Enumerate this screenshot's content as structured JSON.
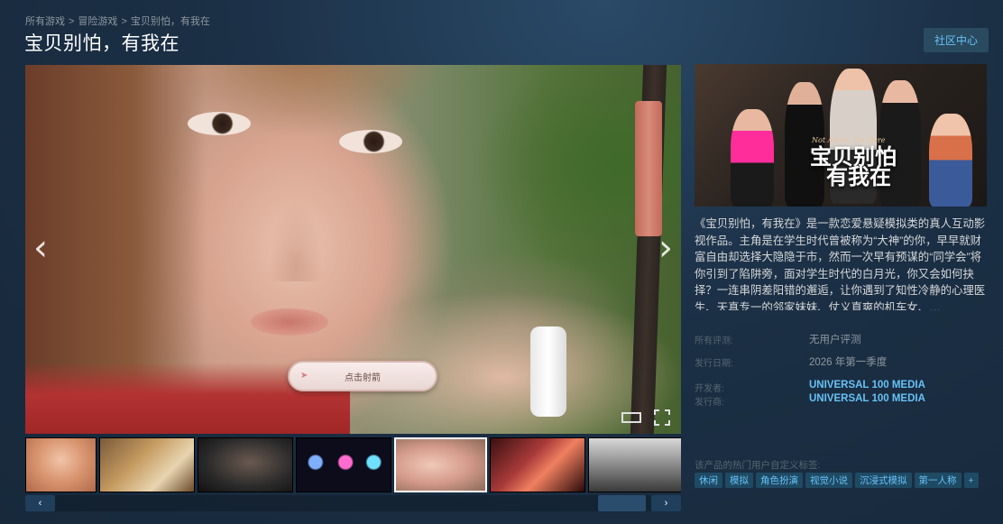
{
  "breadcrumb": [
    "所有游戏",
    "冒险游戏",
    "宝贝别怕，有我在"
  ],
  "breadcrumb_sep": ">",
  "title": "宝贝别怕，有我在",
  "community_button": "社区中心",
  "media": {
    "overlay_button": "点击射箭",
    "prev_arrow": "‹",
    "next_arrow": "›",
    "controls": [
      "windowed-icon",
      "fullscreen-icon"
    ]
  },
  "thumbnails": {
    "count": 7,
    "active_index": 4
  },
  "scroll": {
    "left": "‹",
    "right": "›"
  },
  "capsule": {
    "title_line1": "宝贝别怕",
    "title_line2": "有我在",
    "subtitle": "Not Alone, I'm Here"
  },
  "description": "《宝贝别怕，有我在》是一款恋爱悬疑模拟类的真人互动影视作品。主角是在学生时代曾被称为“大神”的你，早早就财富自由却选择大隐隐于市，然而一次早有预谋的“同学会”将你引到了陷阱旁，面对学生时代的白月光，你又会如何抉择？一连串阴差阳错的邂逅，让你遇到了知性冷静的心理医生、天真专一的邻家妹妹、仗义直爽的机车女、…",
  "meta": {
    "reviews_label": "所有评测:",
    "reviews_value": "无用户评测",
    "release_label": "发行日期:",
    "release_value": "2026 年第一季度",
    "developer_label": "开发者:",
    "developer_value": "UNIVERSAL 100 MEDIA",
    "publisher_label": "发行商:",
    "publisher_value": "UNIVERSAL 100 MEDIA"
  },
  "tags_label": "该产品的热门用户自定义标签:",
  "tags": [
    "休闲",
    "模拟",
    "角色扮演",
    "视觉小说",
    "沉浸式模拟",
    "第一人称",
    "+"
  ],
  "colors": {
    "accent": "#67c1f5",
    "bg": "#1b2f45",
    "tag_bg": "#1f4a64"
  }
}
